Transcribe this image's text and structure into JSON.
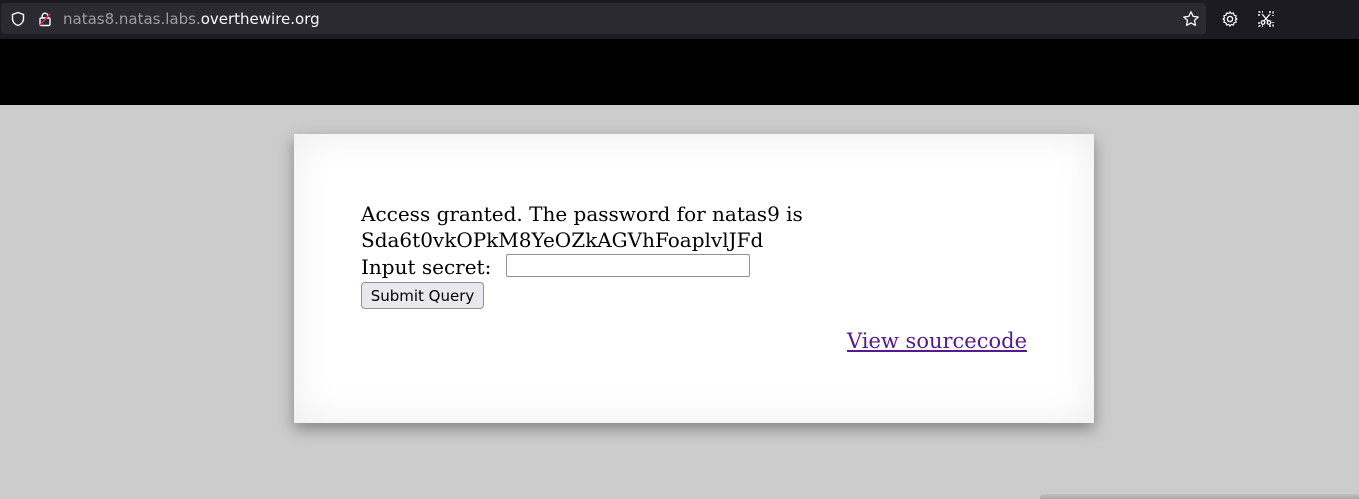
{
  "browser": {
    "url_prefix": "natas8.natas.labs.",
    "url_domain": "overthewire.org",
    "icons": [
      "shield-icon",
      "lock-icon",
      "star-icon",
      "gear-icon",
      "screenshot-icon"
    ]
  },
  "page": {
    "message_line1": "Access granted. The password for natas9 is",
    "message_line2": "Sda6t0vkOPkM8YeOZkAGVhFoaplvlJFd",
    "secret_label": "Input secret:",
    "secret_value": "",
    "submit_label": "Submit Query",
    "source_link": "View sourcecode"
  },
  "colors": {
    "page_background": "#cccccc",
    "header_bar": "#000000",
    "link_visited": "#551a8b"
  }
}
